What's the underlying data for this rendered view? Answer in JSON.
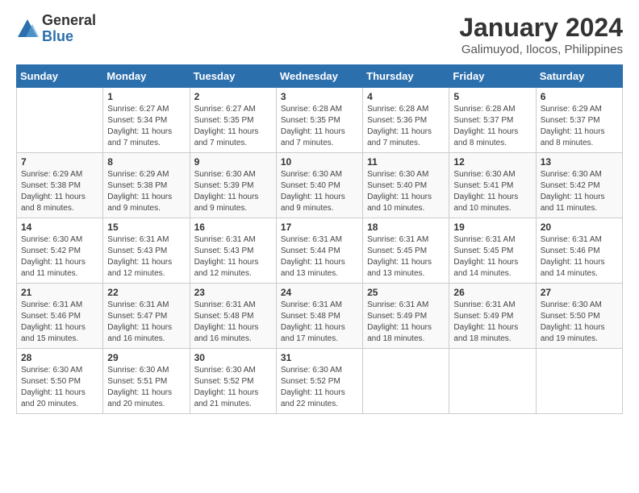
{
  "logo": {
    "general": "General",
    "blue": "Blue"
  },
  "title": "January 2024",
  "subtitle": "Galimuyod, Ilocos, Philippines",
  "weekdays": [
    "Sunday",
    "Monday",
    "Tuesday",
    "Wednesday",
    "Thursday",
    "Friday",
    "Saturday"
  ],
  "weeks": [
    [
      {
        "day": "",
        "info": ""
      },
      {
        "day": "1",
        "info": "Sunrise: 6:27 AM\nSunset: 5:34 PM\nDaylight: 11 hours\nand 7 minutes."
      },
      {
        "day": "2",
        "info": "Sunrise: 6:27 AM\nSunset: 5:35 PM\nDaylight: 11 hours\nand 7 minutes."
      },
      {
        "day": "3",
        "info": "Sunrise: 6:28 AM\nSunset: 5:35 PM\nDaylight: 11 hours\nand 7 minutes."
      },
      {
        "day": "4",
        "info": "Sunrise: 6:28 AM\nSunset: 5:36 PM\nDaylight: 11 hours\nand 7 minutes."
      },
      {
        "day": "5",
        "info": "Sunrise: 6:28 AM\nSunset: 5:37 PM\nDaylight: 11 hours\nand 8 minutes."
      },
      {
        "day": "6",
        "info": "Sunrise: 6:29 AM\nSunset: 5:37 PM\nDaylight: 11 hours\nand 8 minutes."
      }
    ],
    [
      {
        "day": "7",
        "info": "Sunrise: 6:29 AM\nSunset: 5:38 PM\nDaylight: 11 hours\nand 8 minutes."
      },
      {
        "day": "8",
        "info": "Sunrise: 6:29 AM\nSunset: 5:38 PM\nDaylight: 11 hours\nand 9 minutes."
      },
      {
        "day": "9",
        "info": "Sunrise: 6:30 AM\nSunset: 5:39 PM\nDaylight: 11 hours\nand 9 minutes."
      },
      {
        "day": "10",
        "info": "Sunrise: 6:30 AM\nSunset: 5:40 PM\nDaylight: 11 hours\nand 9 minutes."
      },
      {
        "day": "11",
        "info": "Sunrise: 6:30 AM\nSunset: 5:40 PM\nDaylight: 11 hours\nand 10 minutes."
      },
      {
        "day": "12",
        "info": "Sunrise: 6:30 AM\nSunset: 5:41 PM\nDaylight: 11 hours\nand 10 minutes."
      },
      {
        "day": "13",
        "info": "Sunrise: 6:30 AM\nSunset: 5:42 PM\nDaylight: 11 hours\nand 11 minutes."
      }
    ],
    [
      {
        "day": "14",
        "info": "Sunrise: 6:30 AM\nSunset: 5:42 PM\nDaylight: 11 hours\nand 11 minutes."
      },
      {
        "day": "15",
        "info": "Sunrise: 6:31 AM\nSunset: 5:43 PM\nDaylight: 11 hours\nand 12 minutes."
      },
      {
        "day": "16",
        "info": "Sunrise: 6:31 AM\nSunset: 5:43 PM\nDaylight: 11 hours\nand 12 minutes."
      },
      {
        "day": "17",
        "info": "Sunrise: 6:31 AM\nSunset: 5:44 PM\nDaylight: 11 hours\nand 13 minutes."
      },
      {
        "day": "18",
        "info": "Sunrise: 6:31 AM\nSunset: 5:45 PM\nDaylight: 11 hours\nand 13 minutes."
      },
      {
        "day": "19",
        "info": "Sunrise: 6:31 AM\nSunset: 5:45 PM\nDaylight: 11 hours\nand 14 minutes."
      },
      {
        "day": "20",
        "info": "Sunrise: 6:31 AM\nSunset: 5:46 PM\nDaylight: 11 hours\nand 14 minutes."
      }
    ],
    [
      {
        "day": "21",
        "info": "Sunrise: 6:31 AM\nSunset: 5:46 PM\nDaylight: 11 hours\nand 15 minutes."
      },
      {
        "day": "22",
        "info": "Sunrise: 6:31 AM\nSunset: 5:47 PM\nDaylight: 11 hours\nand 16 minutes."
      },
      {
        "day": "23",
        "info": "Sunrise: 6:31 AM\nSunset: 5:48 PM\nDaylight: 11 hours\nand 16 minutes."
      },
      {
        "day": "24",
        "info": "Sunrise: 6:31 AM\nSunset: 5:48 PM\nDaylight: 11 hours\nand 17 minutes."
      },
      {
        "day": "25",
        "info": "Sunrise: 6:31 AM\nSunset: 5:49 PM\nDaylight: 11 hours\nand 18 minutes."
      },
      {
        "day": "26",
        "info": "Sunrise: 6:31 AM\nSunset: 5:49 PM\nDaylight: 11 hours\nand 18 minutes."
      },
      {
        "day": "27",
        "info": "Sunrise: 6:30 AM\nSunset: 5:50 PM\nDaylight: 11 hours\nand 19 minutes."
      }
    ],
    [
      {
        "day": "28",
        "info": "Sunrise: 6:30 AM\nSunset: 5:50 PM\nDaylight: 11 hours\nand 20 minutes."
      },
      {
        "day": "29",
        "info": "Sunrise: 6:30 AM\nSunset: 5:51 PM\nDaylight: 11 hours\nand 20 minutes."
      },
      {
        "day": "30",
        "info": "Sunrise: 6:30 AM\nSunset: 5:52 PM\nDaylight: 11 hours\nand 21 minutes."
      },
      {
        "day": "31",
        "info": "Sunrise: 6:30 AM\nSunset: 5:52 PM\nDaylight: 11 hours\nand 22 minutes."
      },
      {
        "day": "",
        "info": ""
      },
      {
        "day": "",
        "info": ""
      },
      {
        "day": "",
        "info": ""
      }
    ]
  ]
}
